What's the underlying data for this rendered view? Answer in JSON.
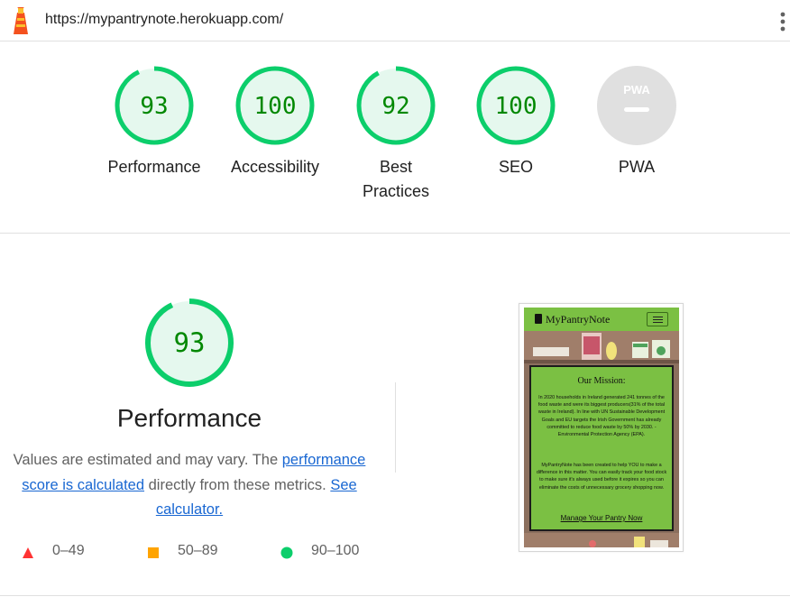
{
  "browser": {
    "url": "https://mypantrynote.herokuapp.com/"
  },
  "colors": {
    "pass": "#0cce6b",
    "pass_fill": "#e5f8ee",
    "pass_text": "#008800",
    "average": "#ffa400",
    "fail": "#ff3333",
    "pwa_gray": "#e0e0e0",
    "link": "#1967d2",
    "app_green": "#7bc043"
  },
  "gauges": [
    {
      "label_line1": "Performance",
      "label_line2": "",
      "score": 93
    },
    {
      "label_line1": "Accessibility",
      "label_line2": "",
      "score": 100
    },
    {
      "label_line1": "Best",
      "label_line2": "Practices",
      "score": 92
    },
    {
      "label_line1": "SEO",
      "label_line2": "",
      "score": 100
    },
    {
      "label_line1": "PWA",
      "label_line2": "",
      "badge": "PWA"
    }
  ],
  "performance": {
    "score": "93",
    "score_value": 93,
    "title": "Performance",
    "desc_part1": "Values are estimated and may vary. The ",
    "desc_link1": "performance score is calculated",
    "desc_part2": " directly from these metrics. ",
    "desc_link2": "See calculator.",
    "legend": [
      {
        "range": "0–49",
        "shape": "triangle",
        "color": "#ff3333"
      },
      {
        "range": "50–89",
        "shape": "square",
        "color": "#ffa400"
      },
      {
        "range": "90–100",
        "shape": "circle",
        "color": "#0cce6b"
      }
    ]
  },
  "thumbnail": {
    "brand": "MyPantryNote",
    "heading": "Our Mission:",
    "paragraph1": "In 2020 households in Ireland generated 241 tonnes of the food waste and were its biggest producers(31% of the total waste in Ireland). In line with UN Sustainable Development Goals and EU targets the Irish Government has already committed to reduce food waste by 50% by 2030. -Environmental Protection Agency (EPA).",
    "paragraph2": "MyPantryNote has been created to help YOU to make a difference in this matter. You can easily track your food stock to make sure it's always used before it expires so you can eliminate the costs of unnecessary grocery shopping now.",
    "cta": "Manage Your Pantry Now"
  }
}
